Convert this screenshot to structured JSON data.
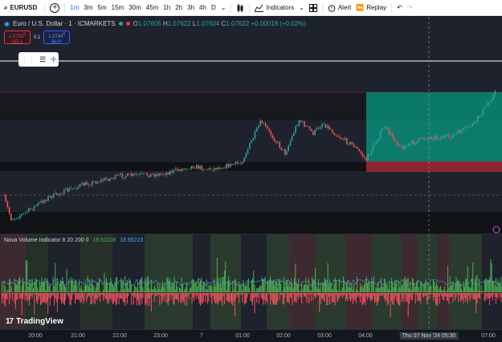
{
  "toolbar": {
    "symbol": "EURUSD",
    "timeframes": [
      "1m",
      "3m",
      "5m",
      "15m",
      "30m",
      "45m",
      "1h",
      "2h",
      "3h",
      "4h",
      "D"
    ],
    "active_timeframe": "1m",
    "indicators_label": "Indicators",
    "alert_label": "Alert",
    "replay_label": "Replay"
  },
  "legend": {
    "title": "Euro / U.S. Dollar · 1 · ICMARKETS",
    "o_label": "O",
    "o": "1.07605",
    "h_label": "H",
    "h": "1.07622",
    "l_label": "L",
    "l": "1.07604",
    "c_label": "C",
    "c": "1.07622",
    "change": "+0.00018 (+0.02%)"
  },
  "trade": {
    "sell_price": "1.0783",
    "sell_sup": "9",
    "sell_label": "SELL",
    "spread": "0.1",
    "buy_price": "1.0784",
    "buy_sup": "0",
    "buy_label": "BUY"
  },
  "indicator": {
    "name": "Nova Volume Indicator 8 20 200 0",
    "value1": "19.51108",
    "value2": "18.96223"
  },
  "branding": {
    "logo_text": "TradingView"
  },
  "time_axis": {
    "labels": [
      "20:00",
      "21:00",
      "22:00",
      "23:00",
      "7",
      "01:00",
      "02:00",
      "03:00",
      "04:00",
      "05:30",
      "07:00"
    ],
    "crosshair_label": "Thu 07 Nov '24  05:30"
  },
  "colors": {
    "up": "#26a69a",
    "down": "#ef5350",
    "long_zone": "#089981",
    "stop_zone": "#f23645",
    "accent": "#2962ff"
  }
}
